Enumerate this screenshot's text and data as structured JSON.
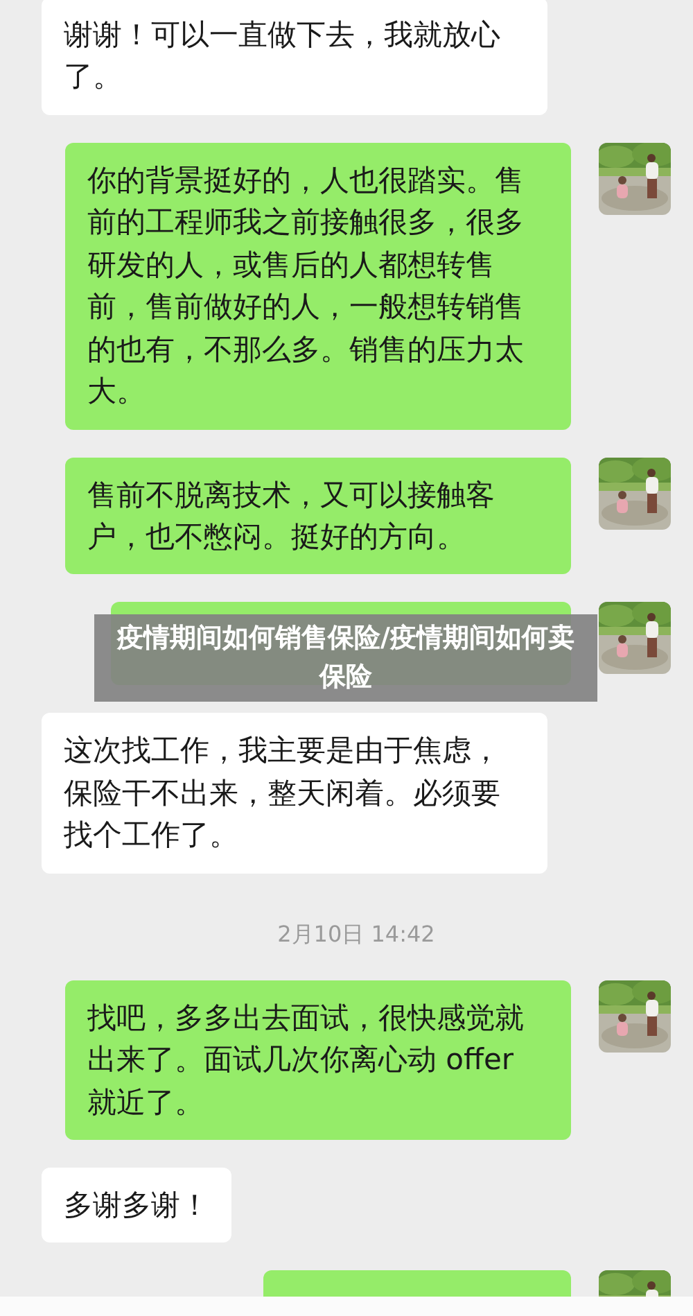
{
  "messages": [
    {
      "kind": "message",
      "outgoing": false,
      "text": "谢谢！可以一直做下去，我就放心了。"
    },
    {
      "kind": "message",
      "outgoing": true,
      "text": "你的背景挺好的，人也很踏实。售前的工程师我之前接触很多，很多研发的人，或售后的人都想转售前，售前做好的人，一般想转销售的也有，不那么多。销售的压力太大。"
    },
    {
      "kind": "message",
      "outgoing": true,
      "text": "售前不脱离技术，又可以接触客户，也不憋闷。挺好的方向。"
    },
    {
      "kind": "message",
      "outgoing": true
    },
    {
      "kind": "message",
      "outgoing": false,
      "text": "这次找工作，我主要是由于焦虑，保险干不出来，整天闲着。必须要找个工作了。"
    },
    {
      "kind": "time",
      "text": "2月10日 14:42"
    },
    {
      "kind": "message",
      "outgoing": true,
      "text": "找吧，多多出去面试，很快感觉就出来了。面试几次你离心动 offer 就近了。"
    },
    {
      "kind": "message",
      "outgoing": false,
      "text": "多谢多谢！"
    },
    {
      "kind": "message",
      "outgoing": true
    }
  ],
  "banner": {
    "title": "疫情期间如何销售保险/疫情期间如何卖保险"
  }
}
